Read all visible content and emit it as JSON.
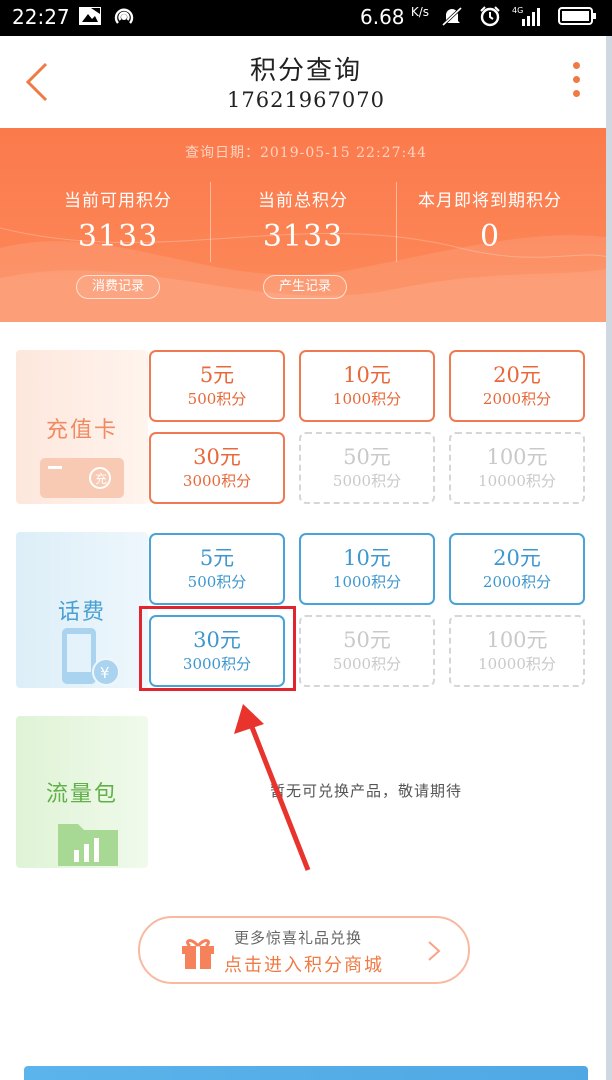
{
  "status_bar": {
    "time": "22:27",
    "speed": "6.68",
    "speed_unit": "K/s",
    "network": "4G"
  },
  "header": {
    "title": "积分查询",
    "phone": "17621967070"
  },
  "summary": {
    "query_date": "查询日期：2019-05-15  22:27:44",
    "stats": [
      {
        "label": "当前可用积分",
        "value": "3133"
      },
      {
        "label": "当前总积分",
        "value": "3133"
      },
      {
        "label": "本月即将到期积分",
        "value": "0"
      }
    ],
    "consume_record": "消费记录",
    "produce_record": "产生记录"
  },
  "categories": {
    "recharge_card": {
      "name": "充值卡",
      "options": [
        {
          "yuan": "5元",
          "points": "500积分",
          "state": "enabled"
        },
        {
          "yuan": "10元",
          "points": "1000积分",
          "state": "enabled"
        },
        {
          "yuan": "20元",
          "points": "2000积分",
          "state": "enabled"
        },
        {
          "yuan": "30元",
          "points": "3000积分",
          "state": "enabled"
        },
        {
          "yuan": "50元",
          "points": "5000积分",
          "state": "disabled"
        },
        {
          "yuan": "100元",
          "points": "10000积分",
          "state": "disabled"
        }
      ]
    },
    "phone_bill": {
      "name": "话费",
      "options": [
        {
          "yuan": "5元",
          "points": "500积分",
          "state": "enabled"
        },
        {
          "yuan": "10元",
          "points": "1000积分",
          "state": "enabled"
        },
        {
          "yuan": "20元",
          "points": "2000积分",
          "state": "enabled"
        },
        {
          "yuan": "30元",
          "points": "3000积分",
          "state": "enabled"
        },
        {
          "yuan": "50元",
          "points": "5000积分",
          "state": "disabled"
        },
        {
          "yuan": "100元",
          "points": "10000积分",
          "state": "disabled"
        }
      ]
    },
    "data_pack": {
      "name": "流量包",
      "empty_text": "暂无可兑换产品，敬请期待"
    }
  },
  "mall": {
    "line1": "更多惊喜礼品兑换",
    "line2": "点击进入积分商城"
  },
  "colors": {
    "accent_orange": "#fb7a4c",
    "blue": "#3e97cf",
    "highlight_red": "#e0262c"
  }
}
